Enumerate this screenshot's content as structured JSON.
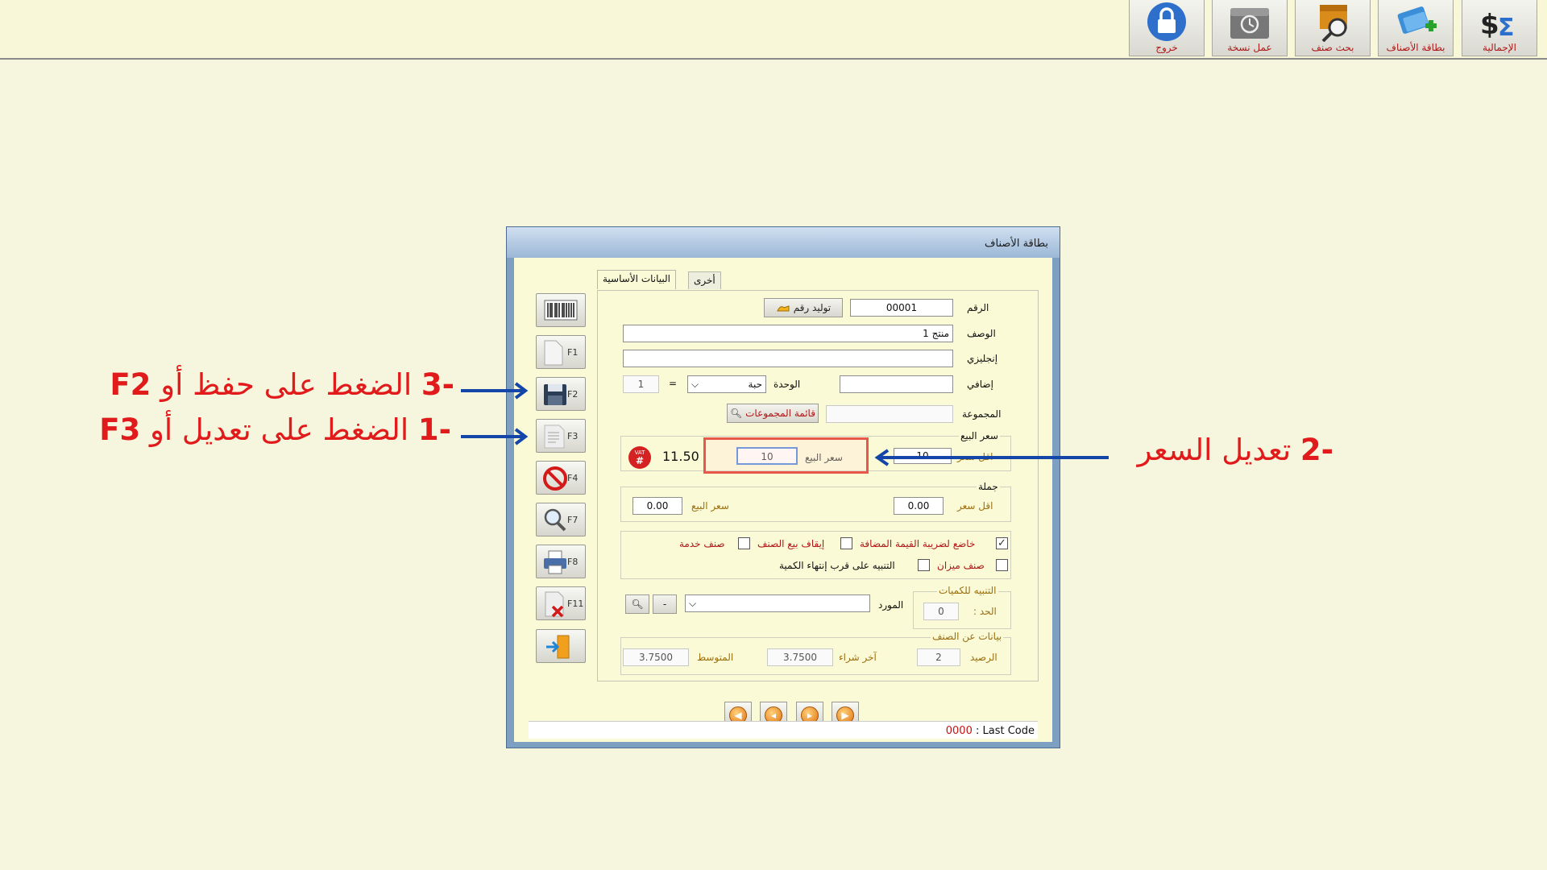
{
  "toolbar": {
    "items": [
      {
        "label": "خروج",
        "icon": "lock-icon"
      },
      {
        "label": "عمل نسخة",
        "icon": "backup-icon"
      },
      {
        "label": "بحث صنف",
        "icon": "search-item-icon"
      },
      {
        "label": "بطاقة الأصناف",
        "icon": "item-card-icon"
      },
      {
        "label": "الإجمالية",
        "icon": "totals-icon"
      }
    ]
  },
  "window": {
    "title": "بطاقة الأصناف",
    "tabs": [
      {
        "label": "البيانات الأساسية",
        "active": true
      },
      {
        "label": "أخرى",
        "active": false
      }
    ],
    "sidebar": {
      "buttons": [
        {
          "icon": "barcode-icon",
          "key": ""
        },
        {
          "icon": "new-document-icon",
          "key": "F1"
        },
        {
          "icon": "save-icon",
          "key": "F2"
        },
        {
          "icon": "edit-document-icon",
          "key": "F3"
        },
        {
          "icon": "cancel-icon",
          "key": "F4"
        },
        {
          "icon": "magnifier-icon",
          "key": "F7"
        },
        {
          "icon": "printer-icon",
          "key": "F8"
        },
        {
          "icon": "delete-document-icon",
          "key": "F11"
        },
        {
          "icon": "exit-door-icon",
          "key": ""
        }
      ]
    },
    "form": {
      "number_label": "الرقم",
      "number_value": "00001",
      "generate_label": "توليد رقم",
      "description_label": "الوصف",
      "description_value": "منتج 1",
      "english_label": "إنجليزي",
      "english_value": "",
      "extra_label": "إضافي",
      "extra_value": "",
      "unit_label": "الوحدة",
      "unit_value": "حبة",
      "equals_sign": "=",
      "unit_qty": "1",
      "group_label": "المجموعة",
      "group_value": "",
      "groups_list_label": "قائمة المجموعات",
      "sale_price_group_title": "سعر البيع",
      "min_price_label": "اقل سعر",
      "min_price_value": "10",
      "sale_price_label": "سعر البيع",
      "sale_price_value": "10",
      "vat_price": "11.50",
      "vat_badge_text": "VAT",
      "wholesale_title": "جملة",
      "wholesale_min_price_label": "اقل سعر",
      "wholesale_min_price_value": "0.00",
      "wholesale_sale_price_label": "سعر البيع",
      "wholesale_sale_price_value": "0.00",
      "checkboxes": [
        {
          "label": "خاضع لضريبة القيمة المضافة",
          "checked": true
        },
        {
          "label": "إيقاف بيع الصنف",
          "checked": false
        },
        {
          "label": "صنف خدمة",
          "checked": false
        },
        {
          "label": "صنف ميزان",
          "checked": false
        },
        {
          "label": "التنبيه على قرب إنتهاء الكمية",
          "checked": false
        }
      ],
      "qty_alert_title": "التنبيه للكميات",
      "limit_label": "الحد :",
      "limit_value": "0",
      "supplier_label": "المورد",
      "supplier_value": "",
      "minus_label": "-",
      "item_info_title": "بيانات عن الصنف",
      "balance_label": "الرصيد",
      "balance_value": "2",
      "last_purchase_label": "آخر شراء",
      "last_purchase_value": "3.7500",
      "average_label": "المتوسط",
      "average_value": "3.7500"
    },
    "status": {
      "last_code_value": "0000",
      "last_code_label": ": Last Code"
    }
  },
  "annotations": [
    {
      "num": "-3",
      "text": "الضغط على حفظ أو",
      "key": "F2"
    },
    {
      "num": "-1",
      "text": "الضغط على تعديل أو",
      "key": "F3"
    },
    {
      "num": "-2",
      "text": "تعديل السعر"
    }
  ],
  "colors": {
    "annotation_red": "#e11b1b",
    "arrow_blue": "#1346a8",
    "highlight_box": "#e8584a",
    "label_orange": "#9b6f12"
  }
}
